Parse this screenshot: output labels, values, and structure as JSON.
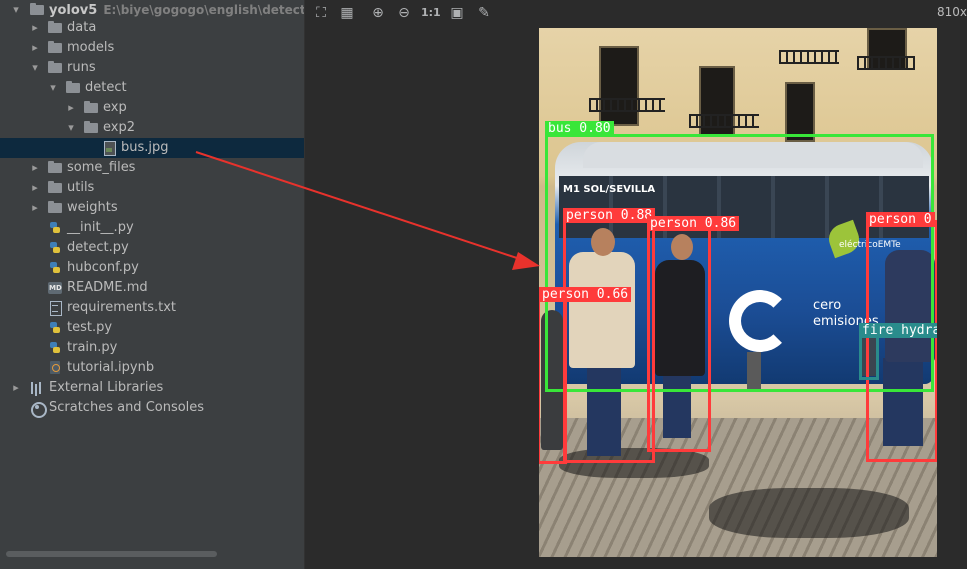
{
  "project_tree": {
    "root": {
      "name": "yolov5",
      "path_hint": "E:\\biye\\gogogo\\english\\detection_y"
    },
    "items": [
      {
        "label": "data",
        "type": "folder",
        "expanded": false
      },
      {
        "label": "models",
        "type": "folder",
        "expanded": false
      },
      {
        "label": "runs",
        "type": "folder",
        "expanded": true
      },
      {
        "label": "detect",
        "type": "folder",
        "expanded": true
      },
      {
        "label": "exp",
        "type": "folder",
        "expanded": false
      },
      {
        "label": "exp2",
        "type": "folder",
        "expanded": true
      },
      {
        "label": "bus.jpg",
        "type": "image",
        "selected": true
      },
      {
        "label": "some_files",
        "type": "folder",
        "expanded": false
      },
      {
        "label": "utils",
        "type": "folder",
        "expanded": false
      },
      {
        "label": "weights",
        "type": "folder",
        "expanded": false
      },
      {
        "label": "__init__.py",
        "type": "python"
      },
      {
        "label": "detect.py",
        "type": "python"
      },
      {
        "label": "hubconf.py",
        "type": "python"
      },
      {
        "label": "README.md",
        "type": "markdown"
      },
      {
        "label": "requirements.txt",
        "type": "text"
      },
      {
        "label": "test.py",
        "type": "python"
      },
      {
        "label": "train.py",
        "type": "python"
      },
      {
        "label": "tutorial.ipynb",
        "type": "notebook"
      },
      {
        "label": "External Libraries",
        "type": "libraries",
        "expanded": false
      },
      {
        "label": "Scratches and Consoles",
        "type": "scratches"
      }
    ]
  },
  "viewer": {
    "toolbar": {
      "actual_size_label": "1:1",
      "size_readout": "810x",
      "icons": [
        "fit-screen-icon",
        "grid-icon",
        "zoom-in-icon",
        "zoom-out-icon",
        "actual-size-icon",
        "background-icon",
        "color-picker-icon"
      ]
    },
    "detections": [
      {
        "label": "bus 0.80",
        "color": "#39e639"
      },
      {
        "label": "person 0.88",
        "color": "#ff3b3b"
      },
      {
        "label": "person 0.86",
        "color": "#ff3b3b"
      },
      {
        "label": "person 0",
        "color": "#ff3b3b"
      },
      {
        "label": "person 0.66",
        "color": "#ff3b3b"
      },
      {
        "label": "fire hydra",
        "color": "#2a8c8c"
      }
    ],
    "bus_signage": {
      "route": "M1 SOL/SEVILLA",
      "brand": "eléctricoEMTe",
      "side_text_1": "cero",
      "side_text_2": "emisiones"
    }
  },
  "annotation": {
    "arrow_color": "#e8322c"
  },
  "colors": {
    "panel_bg": "#3c3f41",
    "editor_bg": "#2b2b2b",
    "selection_bg": "#0d293e"
  }
}
